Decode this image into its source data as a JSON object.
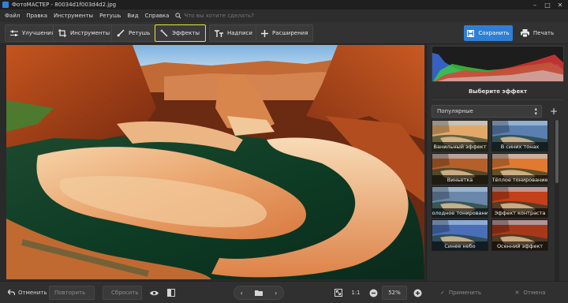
{
  "window": {
    "title": "ФотоМАСТЕР - 80034d1f003d4d2.jpg"
  },
  "menu": {
    "items": [
      "Файл",
      "Правка",
      "Инструменты",
      "Ретушь",
      "Вид",
      "Справка"
    ],
    "search_placeholder": "Что вы хотите сделать?"
  },
  "toolbar": {
    "tabs": [
      "Улучшения",
      "Инструменты",
      "Ретушь",
      "Эффекты",
      "Надписи",
      "Расширения"
    ],
    "active_tab": "Эффекты",
    "save_label": "Сохранить",
    "print_label": "Печать"
  },
  "panel": {
    "title": "Выберите эффект",
    "category": "Популярные",
    "effects": [
      "Ванильный эффект",
      "В синих тонах",
      "Виньетка",
      "Тёплое тонирование",
      "Холодное тонирование",
      "Эффект контраста",
      "Синее небо",
      "Осенний эффект"
    ]
  },
  "bottom": {
    "undo_label": "Отменить",
    "redo_label": "Повторить",
    "reset_label": "Сбросить",
    "zoom_1to1": "1:1",
    "zoom_value": "52%",
    "apply_label": "Применить",
    "cancel_label": "Отмена"
  },
  "colors": {
    "accent": "#2f7fd4",
    "active_border": "#e8e23c"
  }
}
